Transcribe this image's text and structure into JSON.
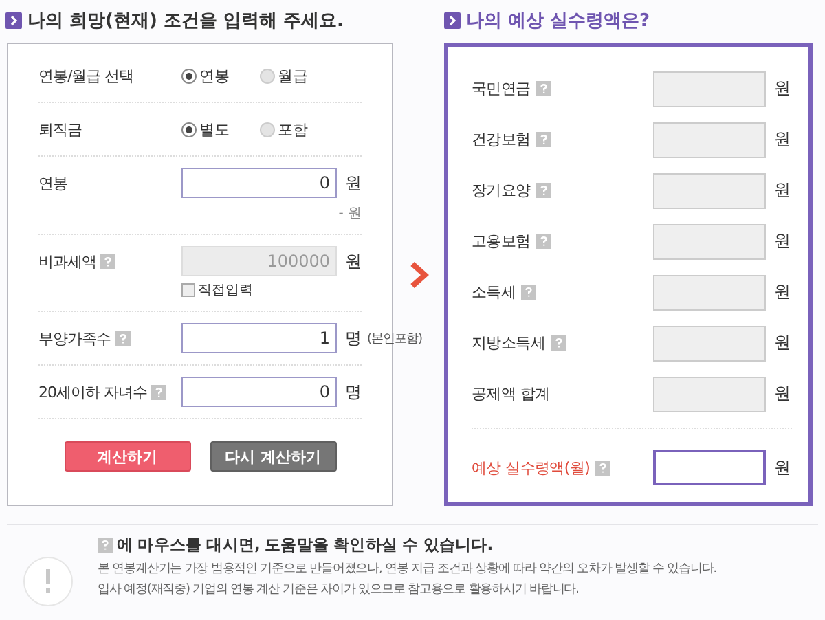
{
  "left_title": "나의 희망(현재) 조건을 입력해 주세요.",
  "conditions": [
    {
      "kind": "radio",
      "label": "연봉/월급 선택",
      "help": false,
      "options": [
        {
          "label": "연봉",
          "selected": true
        },
        {
          "label": "월급",
          "selected": false
        }
      ]
    },
    {
      "kind": "radio",
      "label": "퇴직금",
      "help": false,
      "options": [
        {
          "label": "별도",
          "selected": true
        },
        {
          "label": "포함",
          "selected": false
        }
      ]
    },
    {
      "kind": "input",
      "label": "연봉",
      "help": false,
      "value": "0",
      "unit": "원",
      "disabled": false,
      "note": "- 원"
    },
    {
      "kind": "input",
      "label": "비과세액",
      "help": true,
      "value": "100000",
      "unit": "원",
      "disabled": true,
      "checkbox": {
        "label": "직접입력",
        "checked": false
      }
    },
    {
      "kind": "input",
      "label": "부양가족수",
      "help": true,
      "value": "1",
      "unit": "명",
      "disabled": false,
      "suffix": "(본인포함)"
    },
    {
      "kind": "input",
      "label": "20세이하 자녀수",
      "help": true,
      "value": "0",
      "unit": "명",
      "disabled": false
    }
  ],
  "buttons": [
    {
      "label": "계산하기",
      "kind": "primary"
    },
    {
      "label": "다시 계산하기",
      "kind": "secondary"
    }
  ],
  "right_title": "나의 예상 실수령액은?",
  "results": [
    {
      "kind": "item",
      "label": "국민연금",
      "help": true,
      "unit": "원"
    },
    {
      "kind": "item",
      "label": "건강보험",
      "help": true,
      "unit": "원"
    },
    {
      "kind": "item",
      "label": "장기요양",
      "help": true,
      "unit": "원"
    },
    {
      "kind": "item",
      "label": "고용보험",
      "help": true,
      "unit": "원"
    },
    {
      "kind": "item",
      "label": "소득세",
      "help": true,
      "unit": "원"
    },
    {
      "kind": "item",
      "label": "지방소득세",
      "help": true,
      "unit": "원"
    },
    {
      "kind": "item",
      "label": "공제액 합계",
      "help": false,
      "unit": "원"
    },
    {
      "kind": "total",
      "label": "예상 실수령액(월)",
      "help": true,
      "unit": "원"
    }
  ],
  "notice": {
    "heading": "에 마우스를 대시면, 도움말을 확인하실 수 있습니다.",
    "lines": [
      "본 연봉계산기는 가장 범용적인 기준으로 만들어졌으나, 연봉 지급 조건과 상황에 따라 약간의 오차가 발생할 수 있습니다.",
      "입사 예정(재직중) 기업의 연봉 계산 기준은 차이가 있으므로 참고용으로 활용하시기 바랍니다."
    ]
  }
}
